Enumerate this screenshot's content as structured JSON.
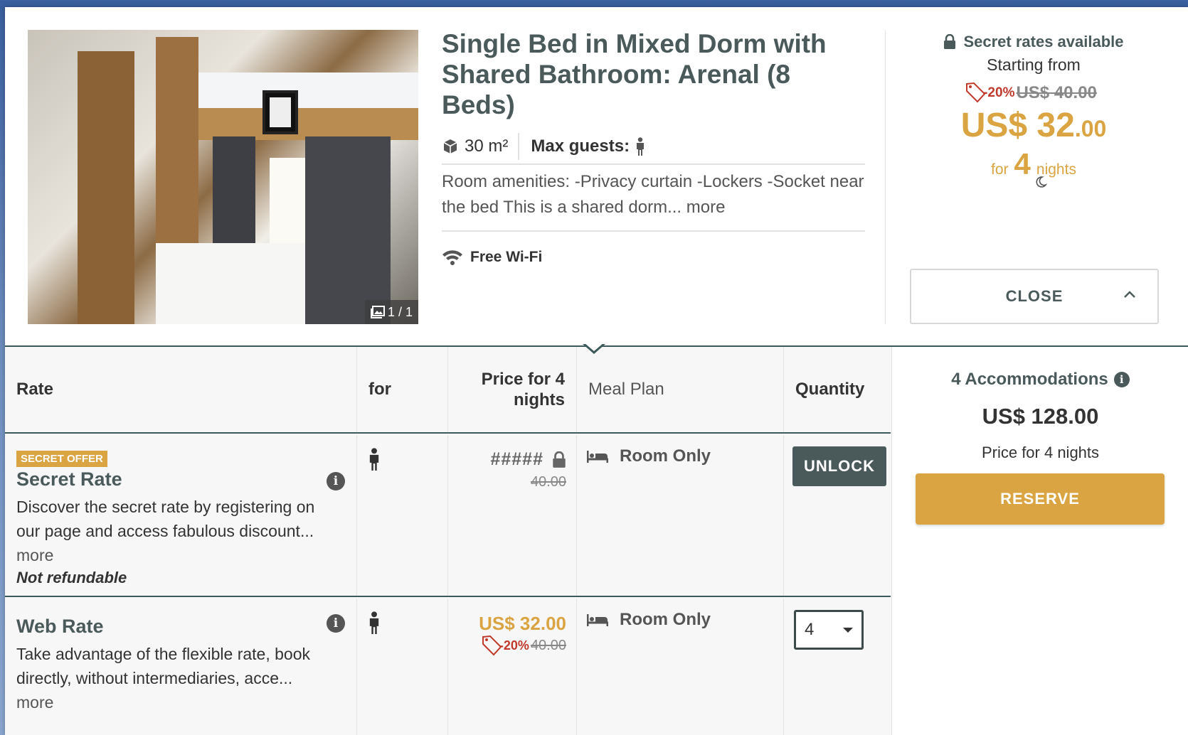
{
  "room": {
    "title": "Single Bed in Mixed Dorm with Shared Bathroom: Arenal (8 Beds)",
    "area": "30 m²",
    "max_guests_label": "Max guests:",
    "amenities": "Room amenities: -Privacy curtain -Lockers -Socket near the bed This is a shared dorm...",
    "amenities_more": "more",
    "wifi": "Free Wi-Fi",
    "photo_counter": "1 / 1"
  },
  "pricing": {
    "secret_rates": "Secret rates available",
    "starting_from": "Starting from",
    "discount": "-20%",
    "old_price": "US$ 40.00",
    "price_main": "US$ 32",
    "price_cents": ".00",
    "for_label": "for",
    "nights_count": "4",
    "nights_label": "nights",
    "close_label": "CLOSE"
  },
  "table": {
    "headers": {
      "rate": "Rate",
      "for": "for",
      "price": "Price for 4 nights",
      "meal": "Meal Plan",
      "quantity": "Quantity"
    },
    "rows": [
      {
        "badge": "SECRET OFFER",
        "name": "Secret Rate",
        "description": "Discover the secret rate by registering on our page and access fabulous discount...",
        "more": "more",
        "refund": "Not refundable",
        "price_hidden": "#####",
        "old_price": "40.00",
        "meal": "Room Only",
        "action": "UNLOCK"
      },
      {
        "name": "Web Rate",
        "description": "Take advantage of the flexible rate, book directly, without intermediaries, acce...",
        "more": "more",
        "price": "US$ 32.00",
        "discount": "-20%",
        "old_price": "40.00",
        "meal": "Room Only",
        "quantity": "4"
      }
    ]
  },
  "summary": {
    "accommodations": "4 Accommodations",
    "total": "US$ 128.00",
    "nights": "Price for 4 nights",
    "reserve": "RESERVE"
  },
  "colors": {
    "accent": "#d9a441",
    "dark": "#4a5a5a",
    "discount": "#c0392b"
  }
}
